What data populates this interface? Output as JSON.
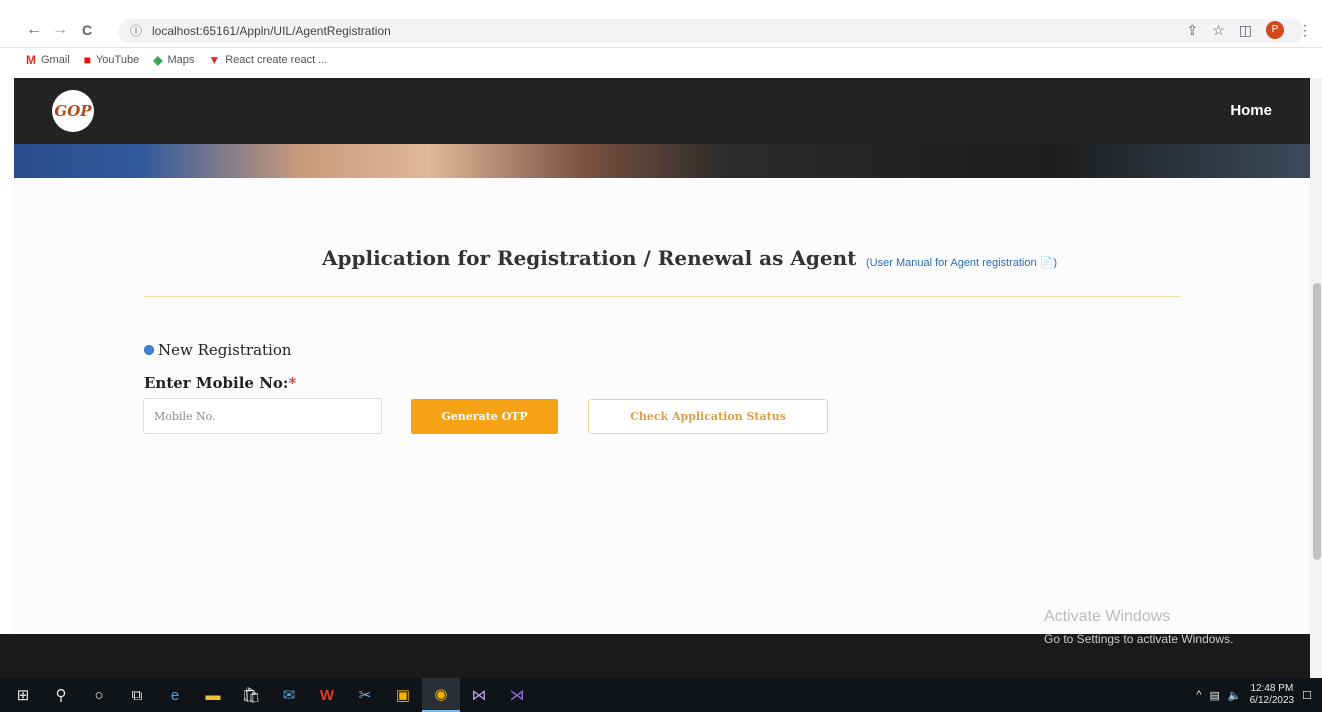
{
  "browser": {
    "back": "←",
    "forward": "→",
    "reload": "C",
    "url": "localhost:65161/Appln/UIL/AgentRegistration",
    "profile_initial": "P"
  },
  "bookmarks": [
    {
      "label": "Gmail",
      "icon": "gmail-icon",
      "glyph": "M",
      "color": "#d93025"
    },
    {
      "label": "YouTube",
      "icon": "youtube-icon",
      "glyph": "■",
      "color": "#ff0000"
    },
    {
      "label": "Maps",
      "icon": "maps-icon",
      "glyph": "◆",
      "color": "#34a853"
    },
    {
      "label": "React create react ...",
      "icon": "react-icon",
      "glyph": "▼",
      "color": "#d93025"
    }
  ],
  "header": {
    "logo_text": "GOP",
    "home_label": "Home"
  },
  "form": {
    "title": "Application for Registration / Renewal as Agent",
    "manual_link": "(User Manual for Agent registration 📄)",
    "radio_label": "New Registration",
    "mobile_label": "Enter Mobile No:",
    "required_mark": "*",
    "mobile_placeholder": "Mobile No.",
    "generate_otp": "Generate OTP",
    "check_status": "Check Application Status"
  },
  "watermark": {
    "line1": "Activate Windows",
    "line2": "Go to Settings to activate Windows."
  },
  "taskbar": {
    "time": "12:48 PM",
    "date": "6/12/2023"
  }
}
